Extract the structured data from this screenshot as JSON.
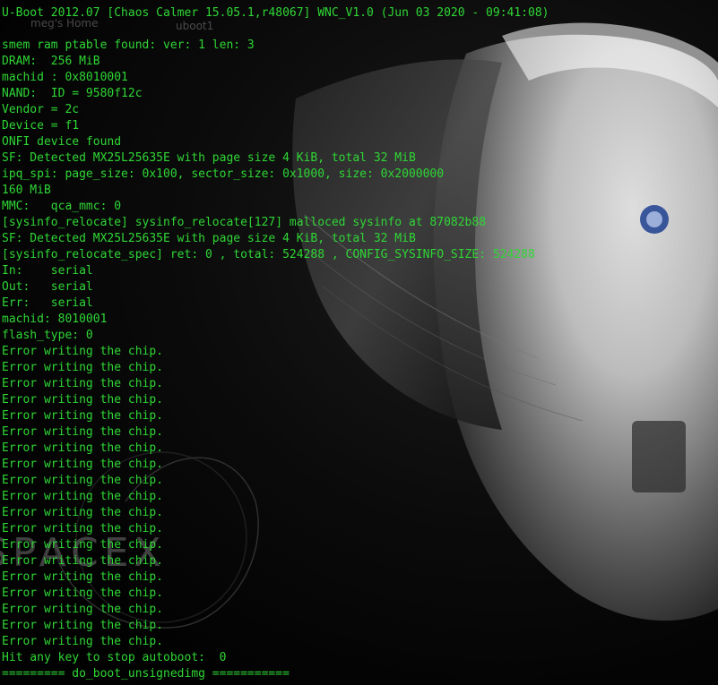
{
  "desktop": {
    "icons": [
      {
        "label": "meg's Home"
      },
      {
        "label": "uboot1"
      }
    ],
    "wallpaper": {
      "watermark_text": "SPACEX"
    }
  },
  "terminal": {
    "text_color": "#2fd635",
    "background": "#000000",
    "lines": [
      "U-Boot 2012.07 [Chaos Calmer 15.05.1,r48067] WNC_V1.0 (Jun 03 2020 - 09:41:08)",
      "",
      "smem ram ptable found: ver: 1 len: 3",
      "DRAM:  256 MiB",
      "machid : 0x8010001",
      "NAND:  ID = 9580f12c",
      "Vendor = 2c",
      "Device = f1",
      "ONFI device found",
      "SF: Detected MX25L25635E with page size 4 KiB, total 32 MiB",
      "ipq_spi: page_size: 0x100, sector_size: 0x1000, size: 0x2000000",
      "160 MiB",
      "MMC:   qca_mmc: 0",
      "[sysinfo_relocate] sysinfo_relocate[127] malloced sysinfo at 87082b88",
      "SF: Detected MX25L25635E with page size 4 KiB, total 32 MiB",
      "[sysinfo_relocate_spec] ret: 0 , total: 524288 , CONFIG_SYSINFO_SIZE: 524288",
      "In:    serial",
      "Out:   serial",
      "Err:   serial",
      "machid: 8010001",
      "flash_type: 0",
      "Error writing the chip.",
      "Error writing the chip.",
      "Error writing the chip.",
      "Error writing the chip.",
      "Error writing the chip.",
      "Error writing the chip.",
      "Error writing the chip.",
      "Error writing the chip.",
      "Error writing the chip.",
      "Error writing the chip.",
      "Error writing the chip.",
      "Error writing the chip.",
      "Error writing the chip.",
      "Error writing the chip.",
      "Error writing the chip.",
      "Error writing the chip.",
      "Error writing the chip.",
      "Error writing the chip.",
      "Error writing the chip.",
      "Hit any key to stop autoboot:  0",
      "========= do_boot_unsignedimg ==========="
    ]
  }
}
